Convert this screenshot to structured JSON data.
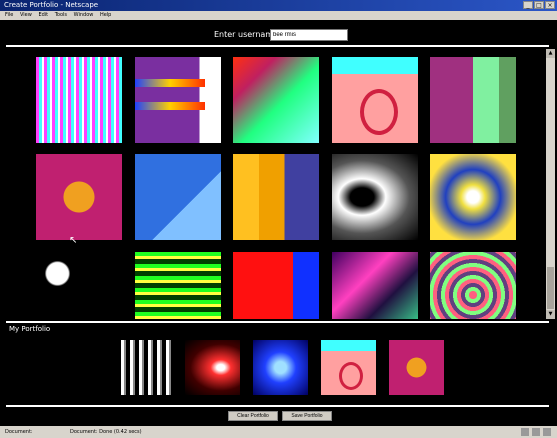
{
  "window": {
    "title": "Create Portfolio - Netscape"
  },
  "window_controls": [
    "_",
    "□",
    "×"
  ],
  "menu": [
    "File",
    "View",
    "Edit",
    "Tools",
    "Window",
    "Help"
  ],
  "username": {
    "label": "Enter username:",
    "value": "bee rmis"
  },
  "gallery": {
    "rows": 3,
    "cols": 5
  },
  "portfolio": {
    "title": "My Portfolio"
  },
  "actions": {
    "left_label": "Clear Portfolio",
    "right_label": "Save Portfolio"
  },
  "status": {
    "left": "Document:",
    "right": "Document: Done (0.42 secs)"
  },
  "colors": {
    "background": "#000000",
    "separator": "#ffffff",
    "titlebar": "#0a2470"
  }
}
